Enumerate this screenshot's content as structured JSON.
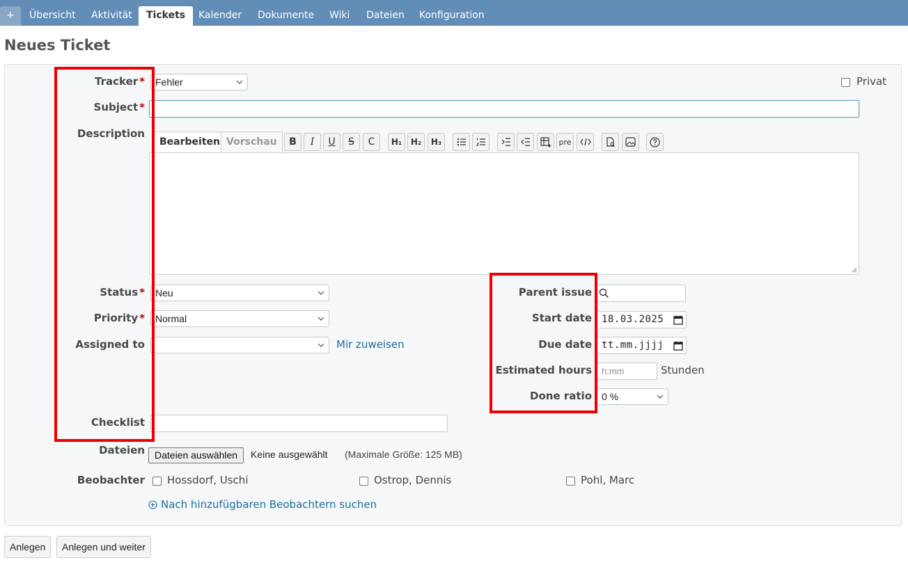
{
  "nav": {
    "plus": "+",
    "tabs": [
      "Übersicht",
      "Aktivität",
      "Tickets",
      "Kalender",
      "Dokumente",
      "Wiki",
      "Dateien",
      "Konfiguration"
    ],
    "selected": "Tickets"
  },
  "page_title": "Neues Ticket",
  "form": {
    "tracker": {
      "label": "Tracker",
      "value": "Fehler"
    },
    "private": {
      "label": "Privat",
      "checked": false
    },
    "subject": {
      "label": "Subject",
      "value": ""
    },
    "description": {
      "label": "Description",
      "tab_edit": "Bearbeiten",
      "tab_preview": "Vorschau",
      "toolbar": [
        "bold",
        "italic",
        "underline",
        "strikethrough",
        "code",
        "h1",
        "h2",
        "h3",
        "bullet-list",
        "numbered-list",
        "indent",
        "outdent",
        "table",
        "pre",
        "code-block",
        "attachment",
        "image",
        "help"
      ],
      "pre_label": "pre"
    },
    "status": {
      "label": "Status",
      "value": "Neu"
    },
    "priority": {
      "label": "Priority",
      "value": "Normal"
    },
    "assigned_to": {
      "label": "Assigned to",
      "value": "",
      "assign_me": "Mir zuweisen"
    },
    "parent_issue": {
      "label": "Parent issue",
      "value": ""
    },
    "start_date": {
      "label": "Start date",
      "value": "18.03.2025"
    },
    "due_date": {
      "label": "Due date",
      "placeholder": "tt.mm.jjjj"
    },
    "estimated_hours": {
      "label": "Estimated hours",
      "placeholder": "h:mm",
      "unit": "Stunden"
    },
    "done_ratio": {
      "label": "Done ratio",
      "value": "0 %"
    },
    "checklist": {
      "label": "Checklist",
      "value": ""
    },
    "files": {
      "label": "Dateien",
      "button": "Dateien auswählen",
      "none": "Keine ausgewählt",
      "max": "(Maximale Größe: 125 MB)"
    },
    "watchers": {
      "label": "Beobachter",
      "people": [
        "Hossdorf, Uschi",
        "Ostrop, Dennis",
        "Pohl, Marc"
      ],
      "search_link": "Nach hinzufügbaren Beobachtern suchen"
    }
  },
  "actions": {
    "create": "Anlegen",
    "create_continue": "Anlegen und weiter"
  },
  "colors": {
    "nav_bar": "#628db6",
    "link": "#1e6e99",
    "required": "#bb0000",
    "highlight": "#ee0000"
  }
}
